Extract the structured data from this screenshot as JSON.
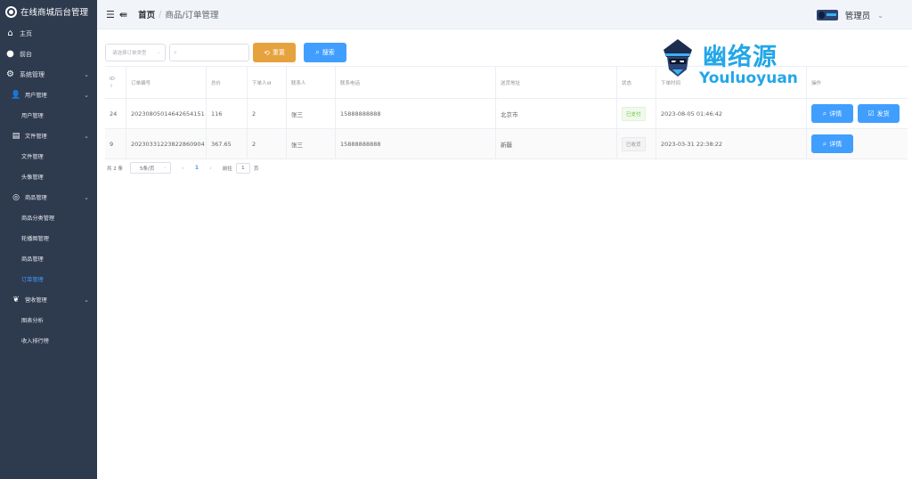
{
  "sidebar": {
    "brand": "在线商城后台管理",
    "home": "主页",
    "front": "前台",
    "system": "系统管理",
    "user_mgmt": "用户管理",
    "user_mgmt_sub": "用户管理",
    "file_mgmt": "文件管理",
    "file_mgmt_sub": "文件管理",
    "avatar_mgmt": "头像管理",
    "goods_mgmt": "商品管理",
    "category_mgmt": "商品分类管理",
    "carousel_mgmt": "轮播图管理",
    "goods_mgmt_sub": "商品管理",
    "order_mgmt": "订单管理",
    "income_mgmt": "营收管理",
    "chart_analysis": "图表分析",
    "income_rank": "收入排行榜"
  },
  "header": {
    "crumb_home": "首页",
    "crumb_sep": "/",
    "crumb_current": "商品/订单管理",
    "user_name": "管理员"
  },
  "toolbar": {
    "select_placeholder": "请选择订单类型",
    "reset_label": "重置",
    "search_label": "搜索"
  },
  "table": {
    "headers": [
      "ID",
      "订单编号",
      "总价",
      "下单人id",
      "联系人",
      "联系电话",
      "送货地址",
      "状态",
      "下单时间",
      "操作"
    ],
    "rows": [
      {
        "id": "24",
        "order_no": "20230805014642654151",
        "total": "116",
        "user_id": "2",
        "contact": "张三",
        "phone": "15888888888",
        "address": "北京市",
        "status": "已支付",
        "time": "2023-08-05 01:46:42",
        "detail_label": "详情",
        "ship_label": "发货"
      },
      {
        "id": "9",
        "order_no": "20230331223822860904",
        "total": "367.65",
        "user_id": "2",
        "contact": "张三",
        "phone": "15888888888",
        "address": "新疆",
        "status": "已收货",
        "time": "2023-03-31 22:38:22",
        "detail_label": "详情"
      }
    ]
  },
  "pager": {
    "total_text": "共 2 条",
    "page_size": "5条/页",
    "current_page": "1",
    "goto_label": "前往",
    "goto_value": "1",
    "page_unit": "页"
  },
  "watermark": {
    "cn": "幽络源",
    "en": "Youluoyuan"
  },
  "colors": {
    "sidebar_bg": "#2e3a4e",
    "primary": "#409eff",
    "warning": "#e6a23c",
    "success": "#67c23a"
  }
}
